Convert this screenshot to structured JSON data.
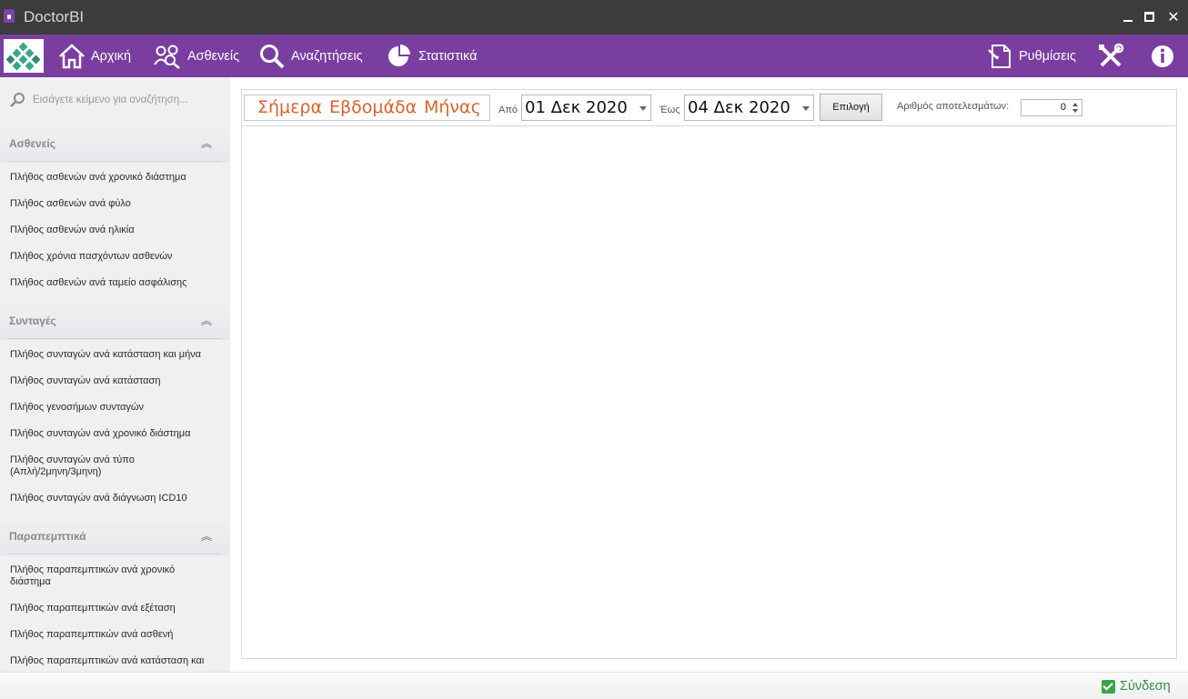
{
  "window": {
    "title": "DoctorBI"
  },
  "toolbar": {
    "home": "Αρχική",
    "patients": "Ασθενείς",
    "searches": "Αναζητήσεις",
    "statistics": "Στατιστικά",
    "settings": "Ρυθμίσεις"
  },
  "sidebar": {
    "search_placeholder": "Εισάγετε κείμενο για αναζήτηση...",
    "groups": [
      {
        "title": "Ασθενείς",
        "items": [
          "Πλήθος ασθενών ανά χρονικό διάστημα",
          "Πλήθος ασθενών ανά φύλο",
          "Πλήθος ασθενών ανά ηλικία",
          "Πλήθος χρόνια πασχόντων ασθενών",
          "Πλήθος ασθενών ανά ταμείο ασφάλισης"
        ]
      },
      {
        "title": "Συνταγές",
        "items": [
          "Πλήθος συνταγών ανά κατάσταση και μήνα",
          "Πλήθος συνταγών ανά κατάσταση",
          "Πλήθος γενοσήμων συνταγών",
          "Πλήθος συνταγών ανά χρονικό διάστημα",
          "Πλήθος συνταγών ανά τύπο (Απλή/2μηνη/3μηνη)",
          "Πλήθος συνταγών ανά διάγνωση ICD10"
        ]
      },
      {
        "title": "Παραπεμπτικά",
        "items": [
          "Πλήθος παραπεμπτικών ανά χρονικό διάστημα",
          "Πλήθος παραπεμπτικών ανά εξέταση",
          "Πλήθος παραπεμπτικών ανά ασθενή",
          "Πλήθος παραπεμπτικών ανά κατάσταση και"
        ]
      }
    ]
  },
  "filters": {
    "today": "Σήμερα",
    "week": "Εβδομάδα",
    "month": "Μήνας",
    "from_label": "Από",
    "from_date": "01 Δεκ 2020",
    "to_label": "Έως",
    "to_date": "04 Δεκ 2020",
    "select_button": "Επιλογή",
    "results_label": "Αριθμός αποτελεσμάτων:",
    "results_value": "0"
  },
  "status": {
    "login": "Σύνδεση"
  },
  "colors": {
    "toolbar": "#7a3ea0",
    "quick_links": "#d9622b",
    "login": "#2f8f3f"
  }
}
